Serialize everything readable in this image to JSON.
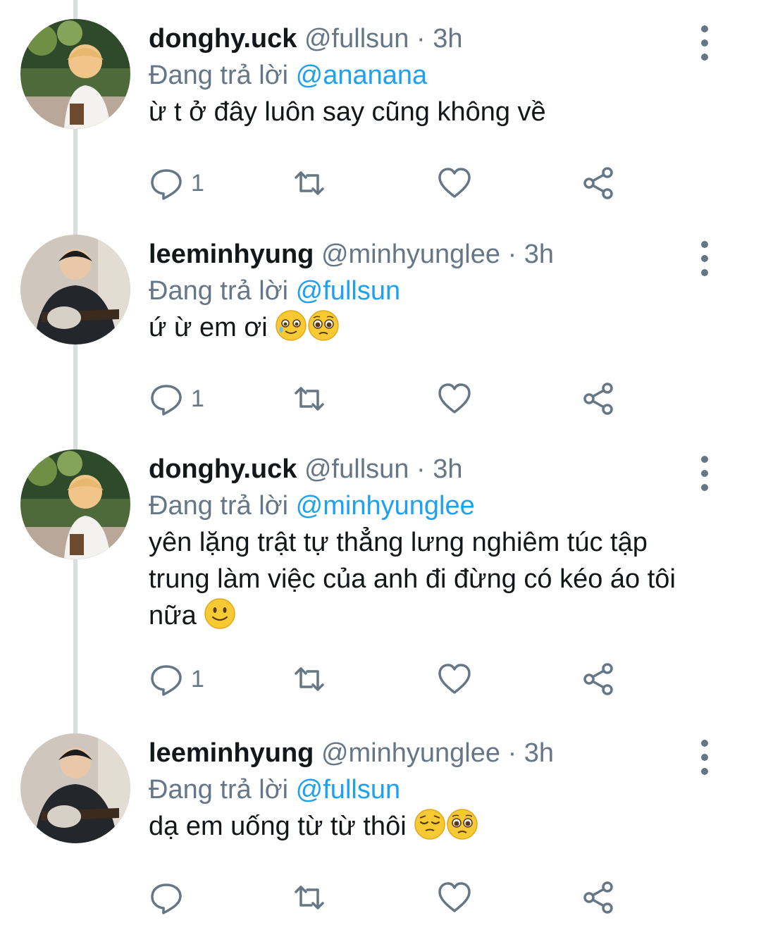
{
  "colors": {
    "link": "#1da1f2",
    "muted": "#657786",
    "text": "#14171a",
    "thread_line": "#d9dde0"
  },
  "tweets": [
    {
      "name": "donghy.uck",
      "handle": "@fullsun",
      "separator": "·",
      "time": "3h",
      "reply_prefix": "Đang trả lời",
      "reply_to": "@ananana",
      "text": "ừ t ở đây luôn say cũng không về",
      "emojis": [],
      "reply_count": "1",
      "avatar": "avatar-blond-person"
    },
    {
      "name": "leeminhyung",
      "handle": "@minhyunglee",
      "separator": "·",
      "time": "3h",
      "reply_prefix": "Đang trả lời",
      "reply_to": "@fullsun",
      "text": "ứ ừ em ơi",
      "emojis": [
        "smiling-face-with-tear-emoji",
        "pleading-face-emoji"
      ],
      "reply_count": "1",
      "avatar": "avatar-guitar-person"
    },
    {
      "name": "donghy.uck",
      "handle": "@fullsun",
      "separator": "·",
      "time": "3h",
      "reply_prefix": "Đang trả lời",
      "reply_to": "@minhyunglee",
      "text": "yên lặng trật tự thẳng lưng nghiêm túc tập trung làm việc của anh đi đừng có kéo áo tôi nữa",
      "emojis": [
        "slightly-smiling-face-emoji"
      ],
      "reply_count": "1",
      "avatar": "avatar-blond-person"
    },
    {
      "name": "leeminhyung",
      "handle": "@minhyunglee",
      "separator": "·",
      "time": "3h",
      "reply_prefix": "Đang trả lời",
      "reply_to": "@fullsun",
      "text": "dạ em uống từ từ thôi",
      "emojis": [
        "pensive-face-emoji",
        "pleading-face-emoji"
      ],
      "reply_count": "",
      "avatar": "avatar-guitar-person"
    }
  ]
}
